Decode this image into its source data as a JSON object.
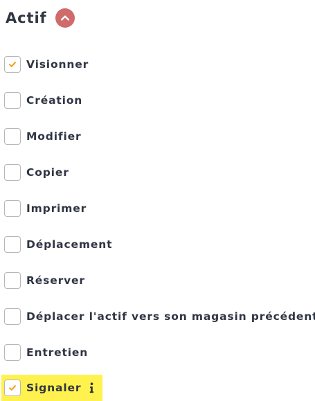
{
  "section": {
    "title": "Actif"
  },
  "permissions": [
    {
      "label": "Visionner",
      "checked": true
    },
    {
      "label": "Création",
      "checked": false
    },
    {
      "label": "Modifier",
      "checked": false
    },
    {
      "label": "Copier",
      "checked": false
    },
    {
      "label": "Imprimer",
      "checked": false
    },
    {
      "label": "Déplacement",
      "checked": false
    },
    {
      "label": "Réserver",
      "checked": false
    },
    {
      "label": "Déplacer l'actif vers son magasin précédent",
      "checked": false
    },
    {
      "label": "Entretien",
      "checked": false
    },
    {
      "label": "Signaler",
      "checked": true,
      "highlighted": true,
      "has_info": true
    }
  ],
  "colors": {
    "text": "#2f3542",
    "checkbox_border": "#b7b7b7",
    "check_mark": "#f39c12",
    "highlight": "#fff24f",
    "collapse_button": "#cf6b6b",
    "info_icon": "#2f2f2f"
  },
  "icons": {
    "collapse": "chevron-up-icon",
    "check": "check-icon",
    "info": "info-icon"
  }
}
